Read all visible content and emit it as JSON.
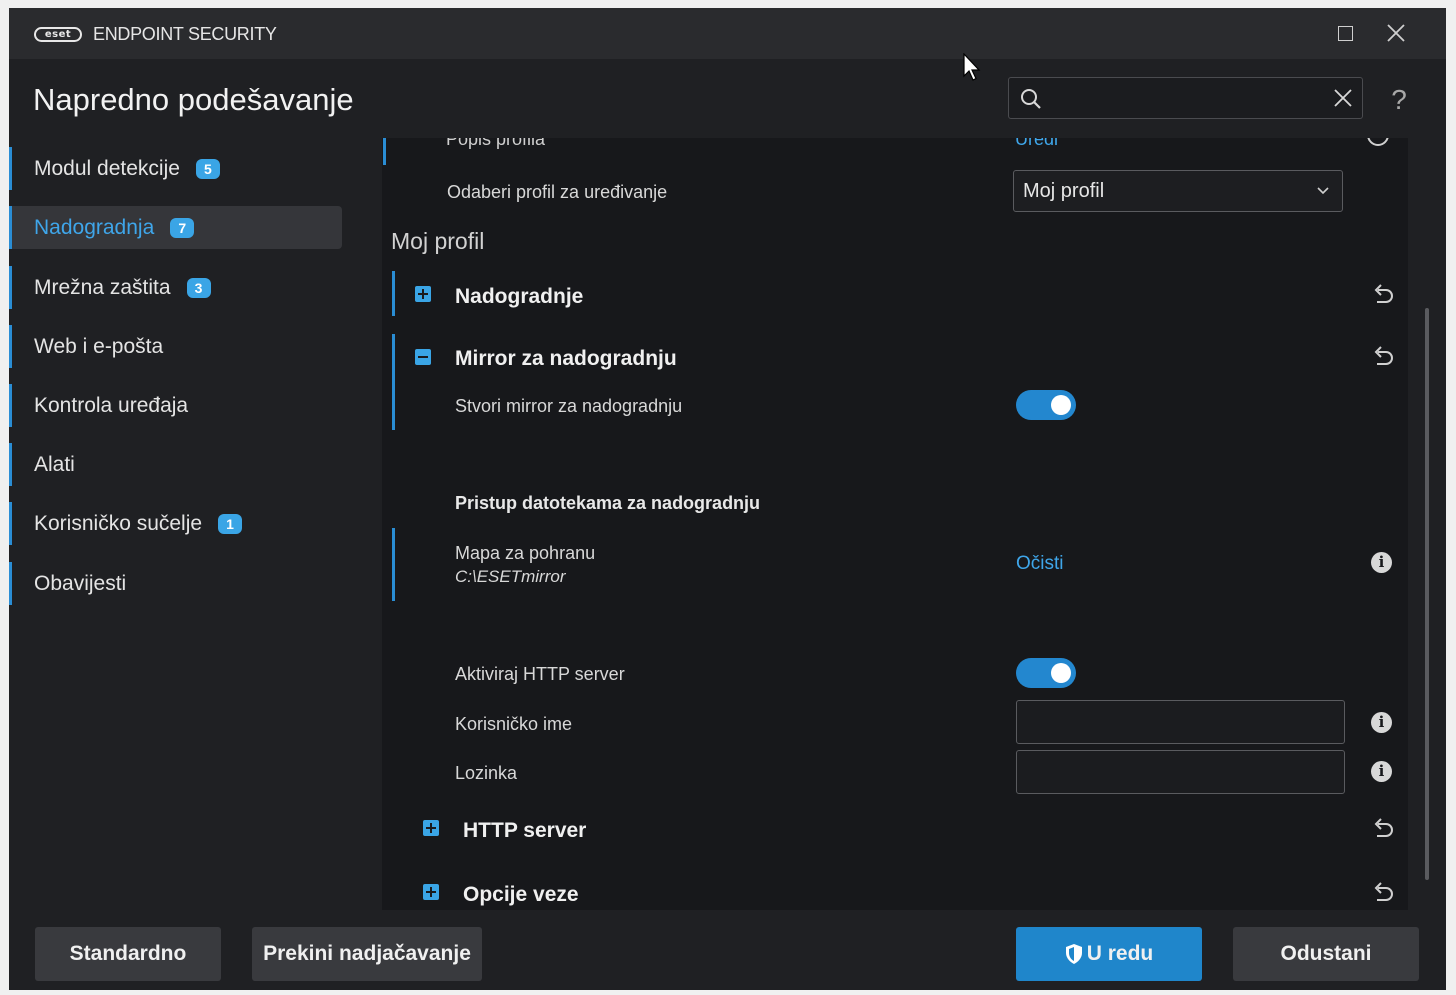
{
  "app": {
    "logo_text": "eset",
    "title": "ENDPOINT SECURITY"
  },
  "header": {
    "page_title": "Napredno podešavanje",
    "search_value": "",
    "help_label": "?"
  },
  "sidebar": {
    "items": [
      {
        "label": "Modul detekcije",
        "badge": "5",
        "active": false
      },
      {
        "label": "Nadogradnja",
        "badge": "7",
        "active": true
      },
      {
        "label": "Mrežna zaštita",
        "badge": "3",
        "active": false
      },
      {
        "label": "Web i e-pošta",
        "badge": "",
        "active": false
      },
      {
        "label": "Kontrola uređaja",
        "badge": "",
        "active": false
      },
      {
        "label": "Alati",
        "badge": "",
        "active": false
      },
      {
        "label": "Korisničko sučelje",
        "badge": "1",
        "active": false
      },
      {
        "label": "Obavijesti",
        "badge": "",
        "active": false
      }
    ]
  },
  "content": {
    "profile_list_label": "Popis profila",
    "profile_list_link": "Uredi",
    "select_profile_label": "Odaberi profil za uređivanje",
    "select_profile_value": "Moj profil",
    "group_title": "Moj profil",
    "sections": {
      "updates": "Nadogradnje",
      "mirror": "Mirror za nadogradnju",
      "http_server": "HTTP server",
      "connection": "Opcije veze"
    },
    "create_mirror_label": "Stvori mirror za nadogradnju",
    "create_mirror_on": true,
    "file_access_title": "Pristup datotekama za nadogradnju",
    "storage_folder_label": "Mapa za pohranu",
    "storage_folder_path": "C:\\ESETmirror",
    "clear_link": "Očisti",
    "http_server_label": "Aktiviraj HTTP server",
    "http_server_on": true,
    "username_label": "Korisničko ime",
    "username_value": "",
    "password_label": "Lozinka",
    "password_value": ""
  },
  "footer": {
    "default_button": "Standardno",
    "revert_button": "Prekini nadjačavanje",
    "ok_button": "U redu",
    "cancel_button": "Odustani"
  },
  "colors": {
    "accent": "#3aa5e6",
    "primary_button": "#1f86cb",
    "background": "#1f2023",
    "panel": "#17181b"
  }
}
